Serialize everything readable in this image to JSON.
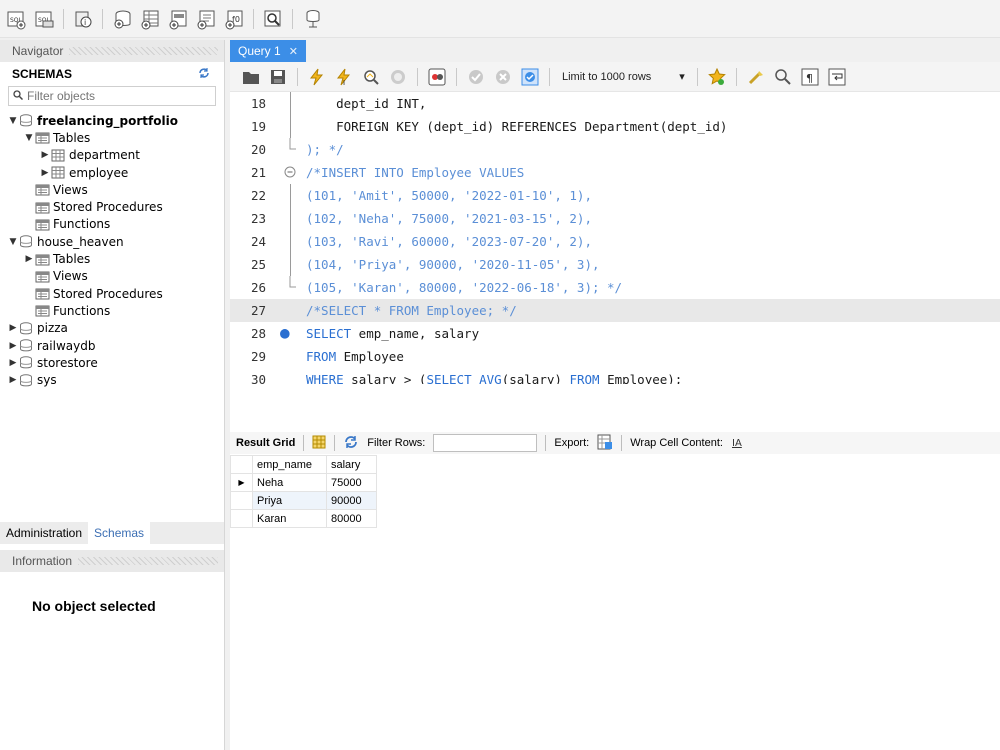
{
  "toolbar": {
    "icons": [
      "new-sql-tab-icon",
      "open-sql-script-icon",
      "inspector-icon",
      "create-schema-icon",
      "create-table-icon",
      "create-view-icon",
      "create-procedure-icon",
      "create-function-icon",
      "search-table-data-icon",
      "reconnect-icon"
    ]
  },
  "navigator": {
    "title": "Navigator",
    "schemas_label": "SCHEMAS",
    "filter_placeholder": "Filter objects",
    "tree": [
      {
        "label": "freelancing_portfolio",
        "level": 0,
        "expanded": true,
        "icon": "database",
        "bold": true
      },
      {
        "label": "Tables",
        "level": 1,
        "expanded": true,
        "icon": "folder"
      },
      {
        "label": "department",
        "level": 2,
        "expanded": false,
        "icon": "table"
      },
      {
        "label": "employee",
        "level": 2,
        "expanded": false,
        "icon": "table"
      },
      {
        "label": "Views",
        "level": 1,
        "icon": "folder"
      },
      {
        "label": "Stored Procedures",
        "level": 1,
        "icon": "folder"
      },
      {
        "label": "Functions",
        "level": 1,
        "icon": "folder"
      },
      {
        "label": "house_heaven",
        "level": 0,
        "expanded": true,
        "icon": "database"
      },
      {
        "label": "Tables",
        "level": 1,
        "expanded": false,
        "icon": "folder"
      },
      {
        "label": "Views",
        "level": 1,
        "icon": "folder"
      },
      {
        "label": "Stored Procedures",
        "level": 1,
        "icon": "folder"
      },
      {
        "label": "Functions",
        "level": 1,
        "icon": "folder"
      },
      {
        "label": "pizza",
        "level": 0,
        "expanded": false,
        "icon": "database"
      },
      {
        "label": "railwaydb",
        "level": 0,
        "expanded": false,
        "icon": "database"
      },
      {
        "label": "storestore",
        "level": 0,
        "expanded": false,
        "icon": "database"
      },
      {
        "label": "sys",
        "level": 0,
        "expanded": false,
        "icon": "database"
      }
    ],
    "tabs": [
      "Administration",
      "Schemas"
    ],
    "active_tab": "Schemas"
  },
  "information": {
    "title": "Information",
    "message": "No object selected"
  },
  "editor": {
    "tab_label": "Query 1",
    "limit_label": "Limit to 1000 rows",
    "lines": [
      {
        "n": "18",
        "text": "    dept_id INT,",
        "style": "plain"
      },
      {
        "n": "19",
        "text": "    FOREIGN KEY (dept_id) REFERENCES Department(dept_id)",
        "style": "plain"
      },
      {
        "n": "20",
        "text": "); */",
        "style": "comment"
      },
      {
        "n": "21",
        "text": "/*INSERT INTO Employee VALUES",
        "style": "comment"
      },
      {
        "n": "22",
        "text": "(101, 'Amit', 50000, '2022-01-10', 1),",
        "style": "comment"
      },
      {
        "n": "23",
        "text": "(102, 'Neha', 75000, '2021-03-15', 2),",
        "style": "comment"
      },
      {
        "n": "24",
        "text": "(103, 'Ravi', 60000, '2023-07-20', 2),",
        "style": "comment"
      },
      {
        "n": "25",
        "text": "(104, 'Priya', 90000, '2020-11-05', 3),",
        "style": "comment"
      },
      {
        "n": "26",
        "text": "(105, 'Karan', 80000, '2022-06-18', 3); */",
        "style": "comment"
      },
      {
        "n": "27",
        "text": "/*SELECT * FROM Employee; */",
        "style": "comment"
      },
      {
        "n": "28",
        "text": "SELECT emp_name, salary",
        "style": "sql"
      },
      {
        "n": "29",
        "text": "FROM Employee",
        "style": "sql"
      },
      {
        "n": "30",
        "text": "WHERE salary > (SELECT AVG(salary) FROM Employee);",
        "style": "sql"
      }
    ]
  },
  "results": {
    "result_grid_label": "Result Grid",
    "filter_rows_label": "Filter Rows:",
    "export_label": "Export:",
    "wrap_label": "Wrap Cell Content:",
    "columns": [
      "emp_name",
      "salary"
    ],
    "rows": [
      [
        "Neha",
        "75000"
      ],
      [
        "Priya",
        "90000"
      ],
      [
        "Karan",
        "80000"
      ]
    ]
  },
  "colors": {
    "accent": "#3c8ee7",
    "keyword": "#2a6fd1",
    "comment": "#5b8fd6"
  }
}
